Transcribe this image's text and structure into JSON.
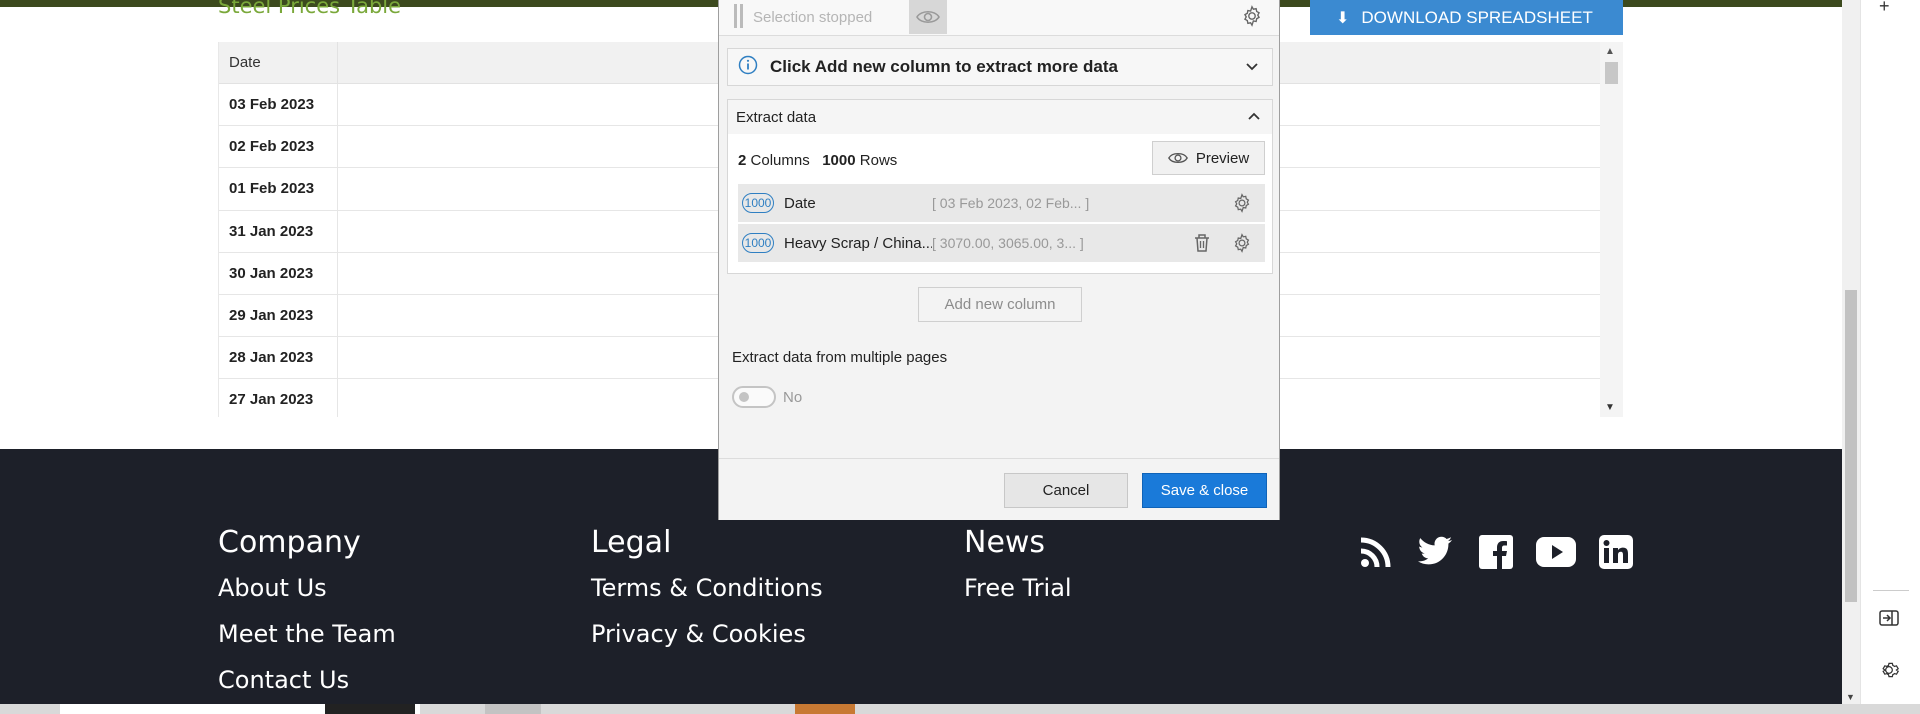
{
  "page": {
    "title": "Steel Prices Table",
    "download_label": "DOWNLOAD SPREADSHEET"
  },
  "table": {
    "header_date": "Date",
    "rows": [
      "03 Feb 2023",
      "02 Feb 2023",
      "01 Feb 2023",
      "31 Jan 2023",
      "30 Jan 2023",
      "29 Jan 2023",
      "28 Jan 2023",
      "27 Jan 2023"
    ]
  },
  "dialog": {
    "status": "Selection stopped",
    "info": "Click Add new column to extract more data",
    "extract_title": "Extract data",
    "columns_count": "2",
    "columns_word": "Columns",
    "rows_count": "1000",
    "rows_word": "Rows",
    "preview_label": "Preview",
    "columns": [
      {
        "badge": "1000",
        "name": "Date",
        "values": "[ 03 Feb 2023, 02 Feb... ]"
      },
      {
        "badge": "1000",
        "name": "Heavy Scrap / China...",
        "values": "[ 3070.00, 3065.00, 3... ]"
      }
    ],
    "add_column_label": "Add new column",
    "multi_page_label": "Extract data from multiple pages",
    "multi_page_value": "No",
    "cancel_label": "Cancel",
    "save_label": "Save & close"
  },
  "footer": {
    "company": {
      "title": "Company",
      "links": [
        "About Us",
        "Meet the Team",
        "Contact Us"
      ]
    },
    "legal": {
      "title": "Legal",
      "links": [
        "Terms & Conditions",
        "Privacy & Cookies"
      ]
    },
    "news": {
      "title": "News",
      "links": [
        "Free Trial"
      ]
    },
    "socials": [
      "rss-icon",
      "twitter-icon",
      "facebook-icon",
      "youtube-icon",
      "linkedin-icon"
    ]
  },
  "colors": {
    "accent_blue": "#1a7ad9",
    "download_blue": "#3b8ad1",
    "title_green": "#7aa83a",
    "footer_bg": "#1d2029"
  }
}
